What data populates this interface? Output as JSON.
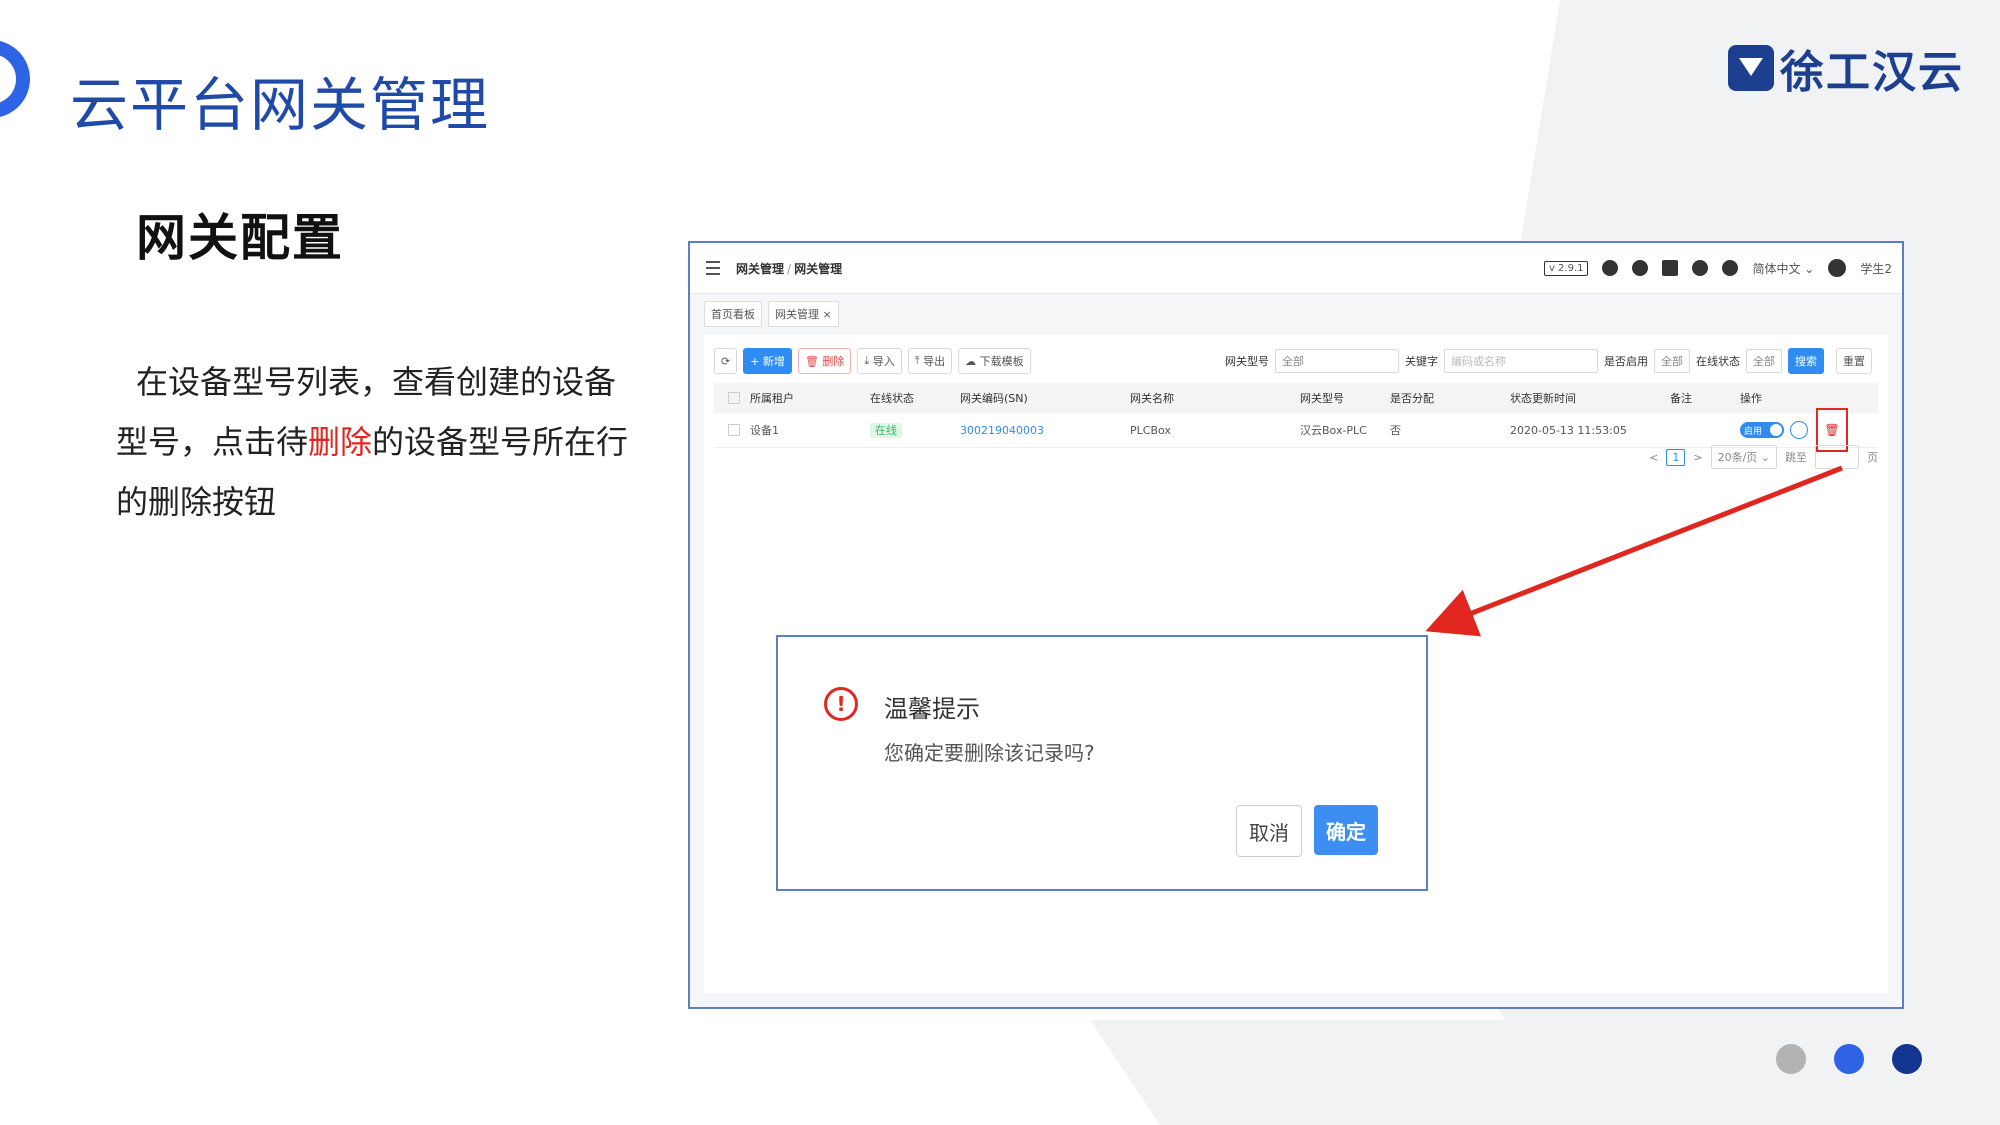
{
  "slide": {
    "title": "云平台网关管理",
    "brand": "徐工汉云",
    "section_title": "网关配置",
    "desc_part1": "在设备型号列表，查看创建的设备型号，点击待",
    "desc_highlight": "删除",
    "desc_part2": "的设备型号所在行的删除按钮"
  },
  "app": {
    "breadcrumb_1": "网关管理",
    "breadcrumb_sep": "/",
    "breadcrumb_2": "网关管理",
    "version": "v 2.9.1",
    "language": "简体中文 ⌄",
    "user": "学生2",
    "tabs": [
      "首页看板",
      "网关管理 ×"
    ],
    "toolbar": {
      "add": "+ 新增",
      "delete": "删除",
      "import": "导入",
      "export": "导出",
      "template": "下载模板"
    },
    "filters": {
      "type_label": "网关型号",
      "type_value": "全部",
      "keyword_label": "关键字",
      "keyword_placeholder": "编码或名称",
      "enabled_label": "是否启用",
      "enabled_value": "全部",
      "online_label": "在线状态",
      "online_value": "全部",
      "search": "搜索",
      "reset": "重置"
    },
    "table": {
      "headers": [
        "所属租户",
        "在线状态",
        "网关编码(SN)",
        "网关名称",
        "网关型号",
        "是否分配",
        "状态更新时间",
        "备注",
        "操作"
      ],
      "row": {
        "tenant": "设备1",
        "status": "在线",
        "sn": "300219040003",
        "name": "PLCBox",
        "model": "汉云Box-PLC",
        "assigned": "否",
        "updated": "2020-05-13 11:53:05",
        "note": "",
        "toggle": "启用"
      }
    },
    "pager": {
      "prev": "<",
      "page": "1",
      "next": ">",
      "size": "20条/页 ⌄",
      "goto": "跳至",
      "page_unit": "页"
    },
    "dialog": {
      "title": "温馨提示",
      "message": "您确定要删除该记录吗?",
      "cancel": "取消",
      "ok": "确定"
    }
  },
  "colors": {
    "title_blue": "#1f4aa8",
    "accent": "#2f8cf0",
    "highlight_red": "#e0261e",
    "dot_gray": "#b3b3b3",
    "dot_blue": "#2f63e6",
    "dot_navy": "#12358f"
  }
}
